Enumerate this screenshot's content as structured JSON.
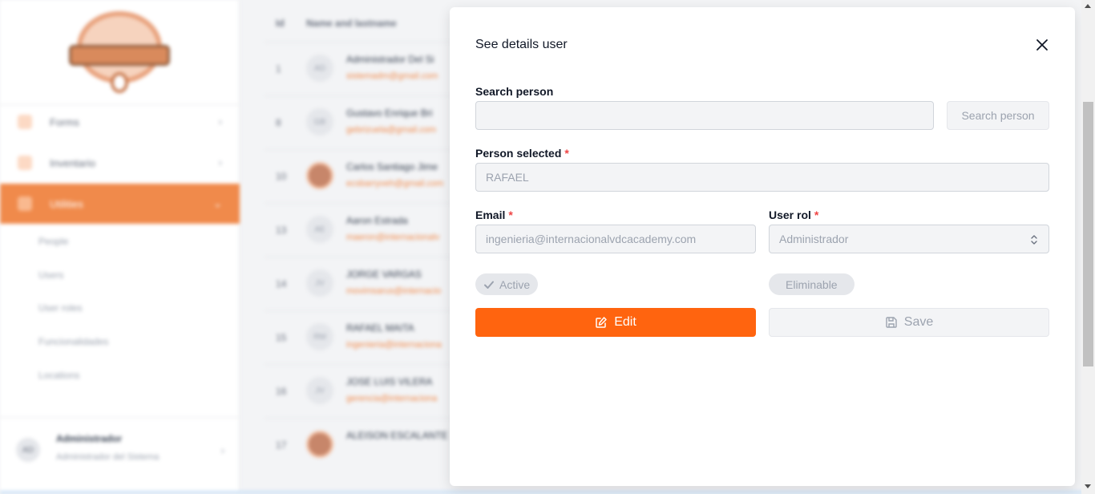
{
  "sidebar": {
    "items": [
      {
        "label": "Forms",
        "icon": "form-icon"
      },
      {
        "label": "Inventario",
        "icon": "box-icon"
      },
      {
        "label": "Utilities",
        "icon": "tools-icon",
        "active": true
      }
    ],
    "sub_items": [
      "People",
      "Users",
      "User roles",
      "Funcionalidades",
      "Locations"
    ],
    "user": {
      "initials": "AD",
      "name": "Administrador",
      "role": "Administrador del Sistema"
    }
  },
  "table": {
    "headers": {
      "id": "Id",
      "name": "Name and lastname"
    },
    "rows": [
      {
        "id": "1",
        "initials": "AD",
        "name": "Administrador Del Si",
        "email": "sistemadm@gmail.com"
      },
      {
        "id": "8",
        "initials": "GB",
        "name": "Gustavo Enrique Bri",
        "email": "gebrizuela@gmail.com"
      },
      {
        "id": "10",
        "initials": "",
        "name": "Carlos Santiago Jime",
        "email": "ecsbarryveh@gmail.com"
      },
      {
        "id": "13",
        "initials": "AE",
        "name": "Aaron Estrada",
        "email": "maeron@internacionalv"
      },
      {
        "id": "14",
        "initials": "JV",
        "name": "JORGE VARGAS",
        "email": "movimsarus@internacio"
      },
      {
        "id": "15",
        "initials": "RM",
        "name": "RAFAEL MAITA",
        "email": "ingenieria@internaciona"
      },
      {
        "id": "16",
        "initials": "JV",
        "name": "JOSE LUIS VILERA",
        "email": "gerencia@internaciona"
      },
      {
        "id": "17",
        "initials": "",
        "name": "ALEISON ESCALANTE",
        "email": ""
      }
    ]
  },
  "modal": {
    "title": "See details user",
    "search_label": "Search person",
    "search_value": "",
    "search_button": "Search person",
    "person_label": "Person selected",
    "person_value": "RAFAEL",
    "email_label": "Email",
    "email_value": "ingenieria@internacionalvdcacademy.com",
    "role_label": "User rol",
    "role_value": "Administrador",
    "required_mark": "*",
    "active_label": "Active",
    "eliminable_label": "Eliminable",
    "edit_button": "Edit",
    "save_button": "Save"
  },
  "colors": {
    "accent": "#ff640f",
    "required": "#ef4444",
    "sidebar_active": "#f08a4b"
  }
}
